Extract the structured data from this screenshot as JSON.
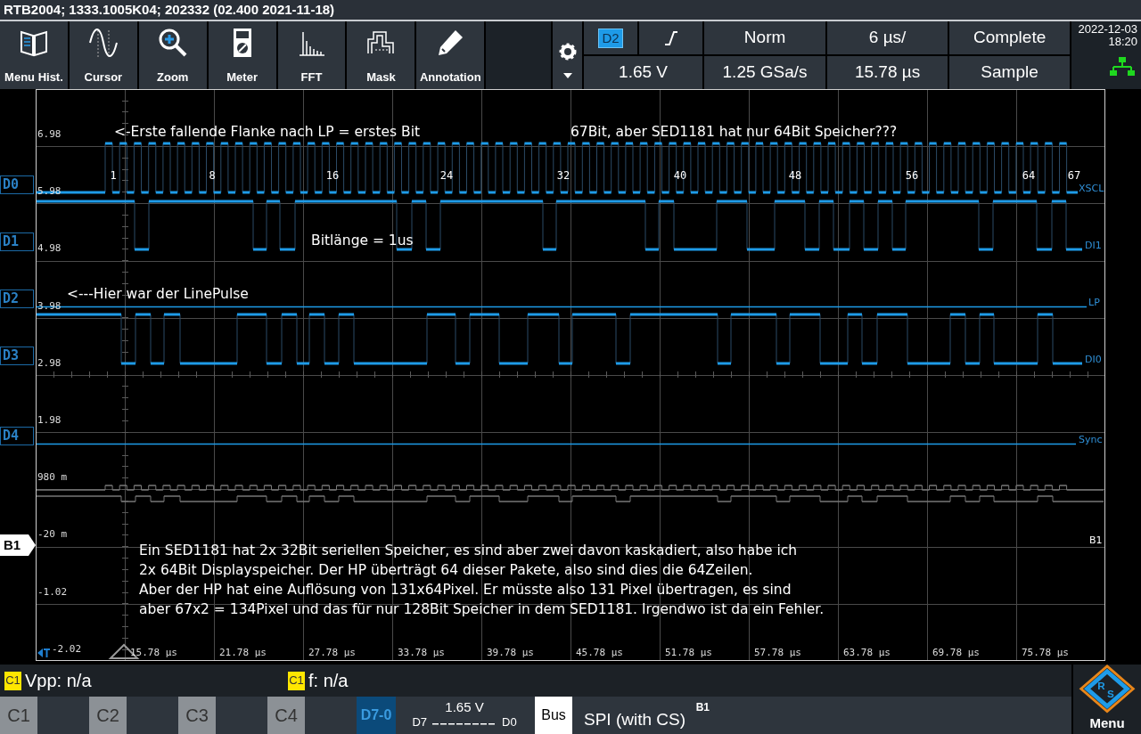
{
  "title_bar": "RTB2004; 1333.1005K04; 202332 (02.400 2021-11-18)",
  "toolbar": [
    {
      "label": "Menu Hist.",
      "kind": "history"
    },
    {
      "label": "Cursor",
      "kind": "cursor"
    },
    {
      "label": "Zoom",
      "kind": "zoom"
    },
    {
      "label": "Meter",
      "kind": "meter"
    },
    {
      "label": "FFT",
      "kind": "fft"
    },
    {
      "label": "Mask",
      "kind": "mask"
    },
    {
      "label": "Annotation",
      "kind": "annotation"
    }
  ],
  "acquisition": {
    "trigger_source": "D2",
    "trigger_mode": "Norm",
    "time_scale": "6 µs/",
    "run_state": "Complete",
    "trigger_level": "1.65 V",
    "sample_rate": "1.25 GSa/s",
    "time_position": "15.78 µs",
    "acquire_mode": "Sample"
  },
  "clock": {
    "date": "2022-12-03",
    "time": "18:20"
  },
  "channels": [
    {
      "label": "D0"
    },
    {
      "label": "D1"
    },
    {
      "label": "D2"
    },
    {
      "label": "D3"
    },
    {
      "label": "D4"
    },
    {
      "label": "B1"
    }
  ],
  "y_axis_labels": [
    "6.98",
    "5.98",
    "4.98",
    "3.98",
    "2.98",
    "1.98",
    "980 m",
    "-20 m",
    "-1.02",
    "-2.02"
  ],
  "x_axis_labels": [
    "15.78 µs",
    "21.78 µs",
    "27.78 µs",
    "33.78 µs",
    "39.78 µs",
    "45.78 µs",
    "51.78 µs",
    "57.78 µs",
    "63.78 µs",
    "69.78 µs",
    "75.78 µs"
  ],
  "bit_markers": [
    "1",
    "8",
    "16",
    "24",
    "32",
    "40",
    "48",
    "56",
    "64",
    "67"
  ],
  "trace_labels": [
    "XSCL",
    "DI1",
    "LP",
    "DI0",
    "Sync",
    "B1"
  ],
  "annotations": [
    {
      "text": "<-Erste fallende Flanke nach LP = erstes Bit"
    },
    {
      "text": "67Bit, aber SED1181 hat nur 64Bit Speicher???"
    },
    {
      "text": "Bitlänge = 1us"
    },
    {
      "text": "<---Hier war der LinePulse"
    },
    {
      "lines": [
        "Ein SED1181 hat 2x 32Bit seriellen Speicher, es sind aber zwei davon kaskadiert, also habe ich",
        "2x 64Bit Displayspeicher. Der HP überträgt 64 dieser Pakete, also sind dies die 64Zeilen.",
        "Aber der HP hat eine Auflösung von 131x64Pixel. Er müsste also 131 Pixel übertragen, es sind",
        "aber 67x2 = 134Pixel und das für nur 128Bit Speicher in dem SED1181. Irgendwo ist da ein Fehler."
      ]
    }
  ],
  "measurements": [
    {
      "source": "C1",
      "text": "Vpp: n/a"
    },
    {
      "source": "C1",
      "text": "f: n/a"
    }
  ],
  "bottom_bar": {
    "analog": [
      {
        "label": "C1"
      },
      {
        "label": "C2"
      },
      {
        "label": "C3"
      },
      {
        "label": "C4"
      }
    ],
    "digital": {
      "label": "D7-0",
      "level": "1.65 V",
      "msb": "D7",
      "lsb": "D0"
    },
    "bus": {
      "label": "Bus",
      "protocol": "SPI (with CS)",
      "name": "B1"
    },
    "menu": {
      "label": "Menu",
      "logo_letters": [
        "R",
        "S"
      ]
    }
  }
}
